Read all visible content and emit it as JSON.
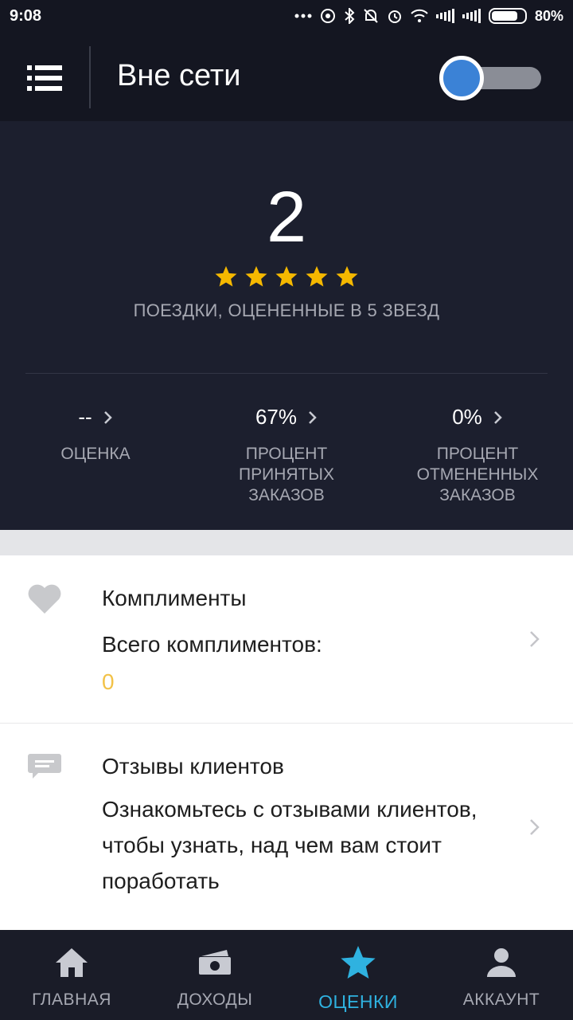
{
  "status_bar": {
    "time": "9:08",
    "battery": "80%",
    "icons": [
      "dots-icon",
      "sync-icon",
      "bluetooth-icon",
      "bell-muted-icon",
      "alarm-icon",
      "wifi-icon",
      "signal-icon",
      "signal-icon",
      "battery-icon"
    ]
  },
  "app_bar": {
    "title": "Вне сети",
    "menu_icon": "list-menu-icon",
    "online_toggle": false
  },
  "rating_summary": {
    "five_star_trips": "2",
    "stars": 5,
    "caption": "ПОЕЗДКИ, ОЦЕНЕННЫЕ В 5 ЗВЕЗД"
  },
  "metrics": [
    {
      "value": "--",
      "label": "ОЦЕНКА"
    },
    {
      "value": "67%",
      "label": "ПРОЦЕНТ ПРИНЯТЫХ ЗАКАЗОВ"
    },
    {
      "value": "0%",
      "label": "ПРОЦЕНТ ОТМЕНЕННЫХ ЗАКАЗОВ"
    }
  ],
  "compliments": {
    "title": "Комплименты",
    "subtitle": "Всего комплиментов:",
    "count": "0",
    "icon": "heart-icon"
  },
  "reviews": {
    "title": "Отзывы клиентов",
    "text": "Ознакомьтесь с отзывами клиентов, чтобы узнать, над чем вам стоит поработать",
    "icon": "chat-bubble-icon"
  },
  "tabs": [
    {
      "label": "ГЛАВНАЯ",
      "icon": "home-icon",
      "active": false
    },
    {
      "label": "ДОХОДЫ",
      "icon": "money-icon",
      "active": false
    },
    {
      "label": "ОЦЕНКИ",
      "icon": "star-icon",
      "active": true
    },
    {
      "label": "АККАУНТ",
      "icon": "person-icon",
      "active": false
    }
  ],
  "colors": {
    "accent": "#2fb2e0",
    "star": "#f5b800",
    "toggle_thumb": "#3b82d6",
    "compliment_count": "#f2c248"
  }
}
